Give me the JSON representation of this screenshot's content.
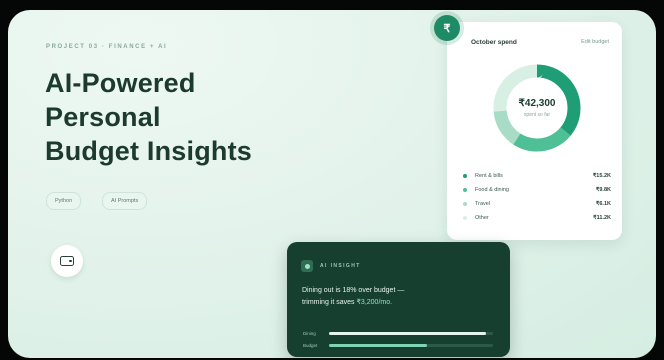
{
  "hero": {
    "eyebrow": "PROJECT 03 · FINANCE + AI",
    "title_lines": [
      "AI-Powered",
      "Personal",
      "Budget Insights"
    ],
    "tags": [
      "Python",
      "AI Prompts"
    ],
    "button_icon": "wallet-icon"
  },
  "spend_card": {
    "badge_symbol": "₹",
    "title": "October spend",
    "link": "Edit budget",
    "total": "₹42,300",
    "total_sub": "spent so far",
    "categories": [
      {
        "label": "Rent & bills",
        "value": "₹15.2K",
        "color": "#1f9d74"
      },
      {
        "label": "Food & dining",
        "value": "₹9.8K",
        "color": "#4fbf95"
      },
      {
        "label": "Travel",
        "value": "₹6.1K",
        "color": "#a8dcc6"
      },
      {
        "label": "Other",
        "value": "₹11.2K",
        "color": "#d8efe4"
      }
    ]
  },
  "insight": {
    "label": "AI INSIGHT",
    "text_main": "Dining out is 18% over budget —",
    "text_sub": "trimming it saves ",
    "text_highlight": "₹3,200/mo.",
    "bars": [
      {
        "label": "Dining",
        "fraction": 0.96,
        "color": "#e6f4ee"
      },
      {
        "label": "Budget",
        "fraction": 0.6,
        "color": "#7fd4b1"
      }
    ]
  },
  "colors": {
    "accent": "#1f8a66",
    "dark_card": "#173f30",
    "title": "#1c3a30"
  }
}
